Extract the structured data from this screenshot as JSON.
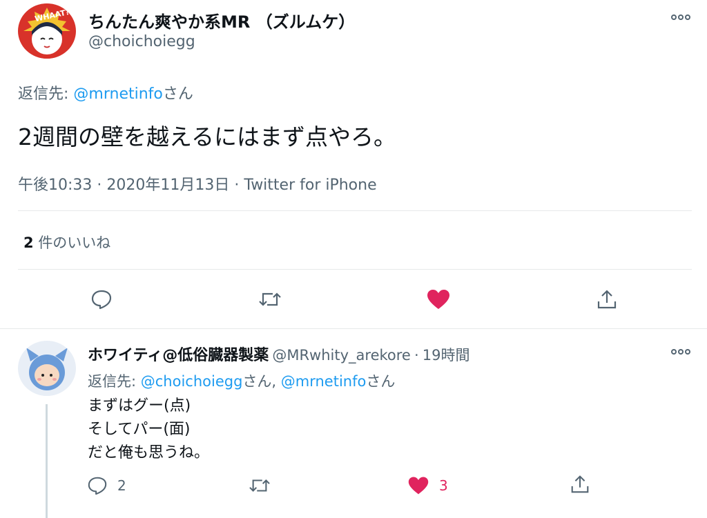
{
  "tweet": {
    "author_name": "ちんたん爽やか系MR （ズルムケ）",
    "author_handle": "@choichoiegg",
    "avatar_badge_text": "WHAAT?",
    "reply_prefix": "返信先: ",
    "reply_to": "@mrnetinfo",
    "reply_suffix": "さん",
    "text": "2週間の壁を越えるにはまず点やろ。",
    "time": "午後10:33",
    "date": "2020年11月13日",
    "source": "Twitter for iPhone",
    "meta_sep": "·",
    "likes_count": "2",
    "likes_label": "件のいいね"
  },
  "reply": {
    "author_name": "ホワイティ@低俗臓器製薬",
    "author_handle": "@MRwhity_arekore",
    "time_sep": "·",
    "time": "19時間",
    "reply_prefix": "返信先: ",
    "reply_to_1": "@choichoiegg",
    "reply_mid": "さん, ",
    "reply_to_2": "@mrnetinfo",
    "reply_suffix": "さん",
    "lines": [
      "まずはグー(点)",
      "そしてパー(面)",
      "だと俺も思うね。"
    ],
    "reply_count": "2",
    "like_count": "3"
  },
  "icons": {
    "more": "more-icon",
    "reply": "reply-icon",
    "retweet": "retweet-icon",
    "like": "heart-icon",
    "share": "share-icon"
  },
  "colors": {
    "accent": "#1d9bf0",
    "like": "#f91880",
    "secondary_text": "#536471",
    "divider": "#e7e9ea"
  }
}
